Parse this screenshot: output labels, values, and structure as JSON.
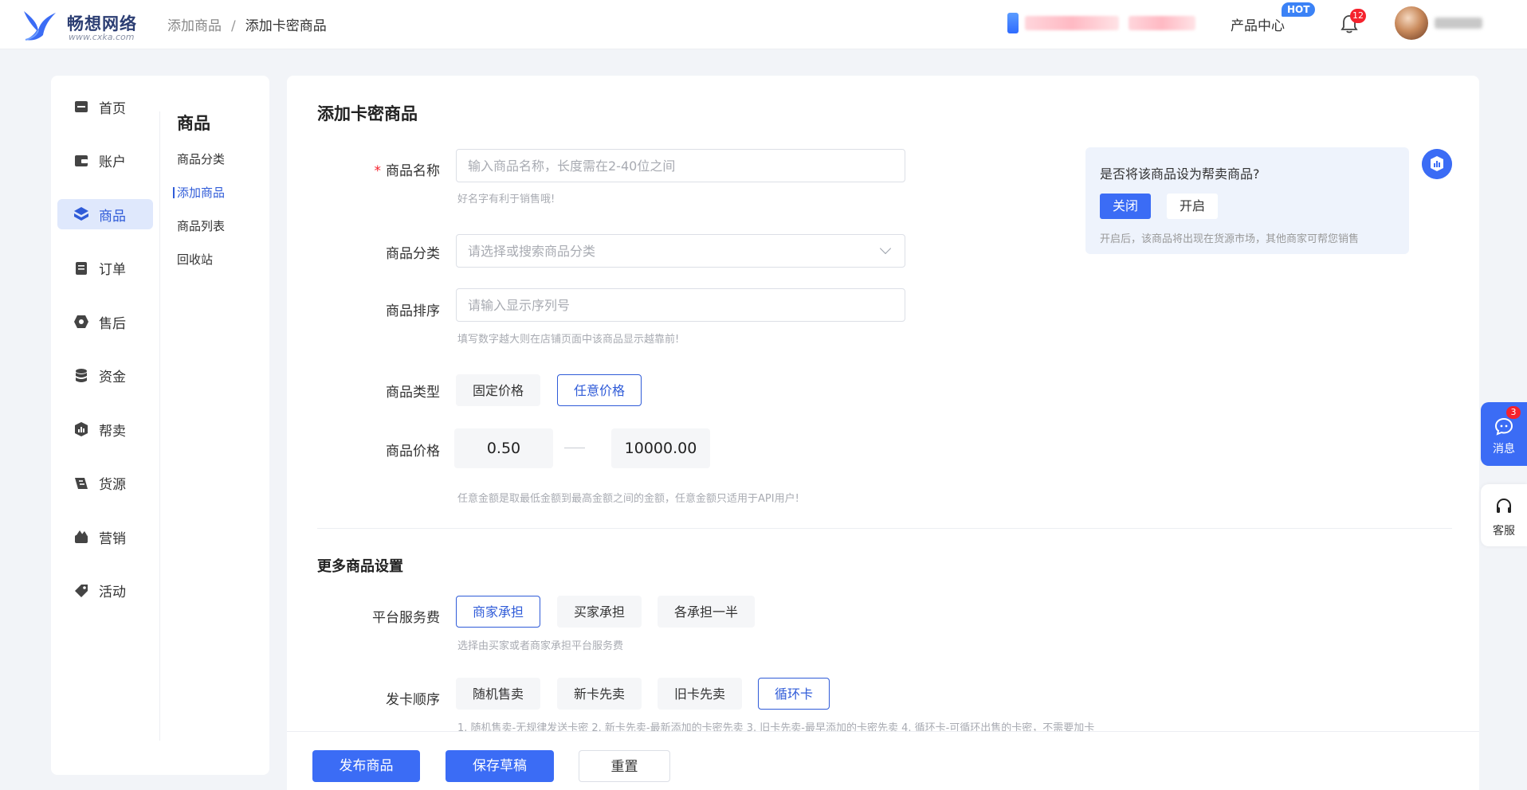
{
  "brand": {
    "name": "畅想网络",
    "domain": "www.cxka.com",
    "color": "#3b6cf5"
  },
  "header": {
    "breadcrumb": [
      "添加商品",
      "添加卡密商品"
    ],
    "breadcrumb_sep": "/",
    "product_center": "产品中心",
    "hot_badge": "HOT",
    "notification_count": "12"
  },
  "sidebar": {
    "primary": [
      {
        "label": "首页",
        "icon": "store-icon"
      },
      {
        "label": "账户",
        "icon": "wallet-icon"
      },
      {
        "label": "商品",
        "icon": "cube-icon",
        "active": true
      },
      {
        "label": "订单",
        "icon": "order-icon"
      },
      {
        "label": "售后",
        "icon": "aftersale-icon"
      },
      {
        "label": "资金",
        "icon": "coins-icon"
      },
      {
        "label": "帮卖",
        "icon": "helpsell-icon"
      },
      {
        "label": "货源",
        "icon": "supply-icon"
      },
      {
        "label": "营销",
        "icon": "marketing-icon"
      },
      {
        "label": "活动",
        "icon": "activity-icon"
      }
    ],
    "secondary_title": "商品",
    "secondary": [
      {
        "label": "商品分类"
      },
      {
        "label": "添加商品",
        "active": true
      },
      {
        "label": "商品列表"
      },
      {
        "label": "回收站"
      }
    ]
  },
  "form": {
    "title": "添加卡密商品",
    "required_mark": "*",
    "name": {
      "label": "商品名称",
      "placeholder": "输入商品名称，长度需在2-40位之间",
      "hint": "好名字有利于销售哦!"
    },
    "category": {
      "label": "商品分类",
      "placeholder": "请选择或搜索商品分类"
    },
    "sort": {
      "label": "商品排序",
      "placeholder": "请输入显示序列号",
      "hint": "填写数字越大则在店铺页面中该商品显示越靠前!"
    },
    "type": {
      "label": "商品类型",
      "options": [
        "固定价格",
        "任意价格"
      ],
      "selected": "任意价格"
    },
    "price": {
      "label": "商品价格",
      "min": "0.50",
      "max": "10000.00",
      "hint": "任意金额是取最低金额到最高金额之间的金额，任意金额只适用于API用户!"
    },
    "more_title": "更多商品设置",
    "service_fee": {
      "label": "平台服务费",
      "options": [
        "商家承担",
        "买家承担",
        "各承担一半"
      ],
      "selected": "商家承担",
      "hint": "选择由买家或者商家承担平台服务费"
    },
    "card_order": {
      "label": "发卡顺序",
      "options": [
        "随机售卖",
        "新卡先卖",
        "旧卡先卖",
        "循环卡"
      ],
      "selected": "循环卡",
      "hint": "1. 随机售卖-无规律发送卡密 2. 新卡先卖-最新添加的卡密先卖 3. 旧卡先卖-最早添加的卡密先卖 4. 循环卡-可循环出售的卡密，不需要加卡"
    }
  },
  "help_sell": {
    "question": "是否将该商品设为帮卖商品?",
    "off_label": "关闭",
    "on_label": "开启",
    "note": "开启后，该商品将出现在货源市场，其他商家可帮您销售"
  },
  "actions": {
    "publish": "发布商品",
    "save_draft": "保存草稿",
    "reset": "重置"
  },
  "float": {
    "message_label": "消息",
    "message_count": "3",
    "service_label": "客服"
  }
}
